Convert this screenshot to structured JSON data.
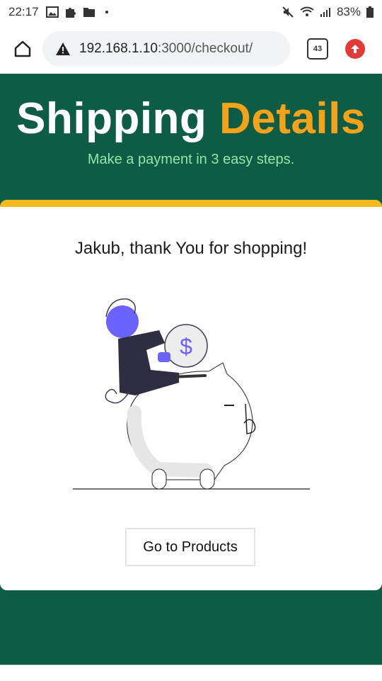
{
  "status_bar": {
    "time": "22:17",
    "battery": "83%",
    "icons": [
      "gallery-icon",
      "puzzle-icon",
      "folder-icon",
      "dot-icon",
      "mute-icon",
      "wifi-icon",
      "signal-icon",
      "battery-icon"
    ]
  },
  "browser": {
    "url_host": "192.168.1.10",
    "url_path": ":3000/checkout/",
    "tab_count": "43"
  },
  "hero": {
    "title_main": "Shipping",
    "title_accent": "Details",
    "subtitle": "Make a payment in 3 easy steps."
  },
  "card": {
    "message": "Jakub, thank You for shopping!",
    "button_label": "Go to Products"
  },
  "colors": {
    "hero_bg": "#0d5c45",
    "accent": "#f4a218",
    "subtitle": "#8ee8a8",
    "card_stripe": "#f5b920",
    "illustration_purple": "#6c63ff"
  }
}
